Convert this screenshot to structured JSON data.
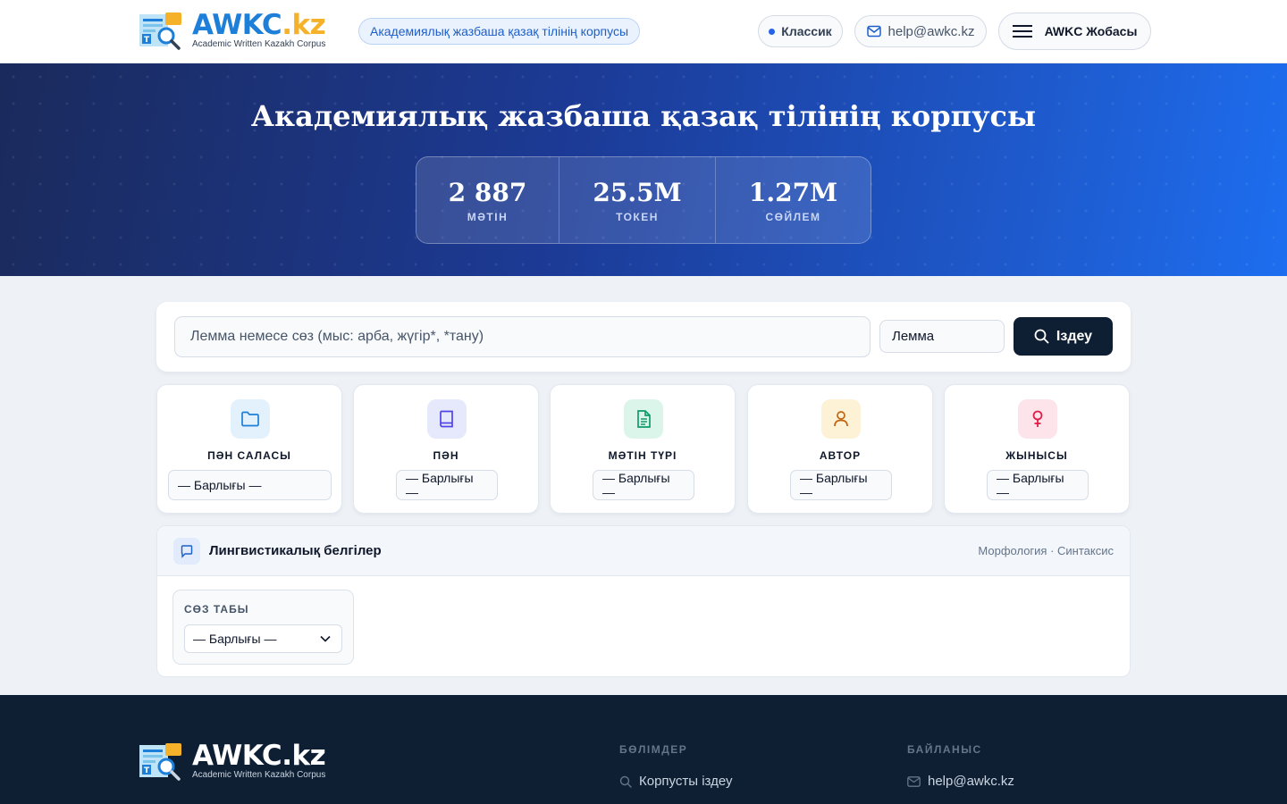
{
  "header": {
    "logo_title": "AWKC",
    "logo_tld": ".kz",
    "logo_sub": "Academic Written Kazakh Corpus",
    "corpus_pill": "Академиялық жазбаша қазақ тілінің корпусы",
    "classic_label": "Классик",
    "email": "help@awkc.kz",
    "project_label": "AWKC Жобасы"
  },
  "hero": {
    "title": "Академиялық жазбаша қазақ тілінің корпусы",
    "stats": [
      {
        "value": "2 887",
        "label": "МӘТІН"
      },
      {
        "value": "25.5M",
        "label": "ТОКЕН"
      },
      {
        "value": "1.27M",
        "label": "СӨЙЛЕМ"
      }
    ]
  },
  "search": {
    "placeholder": "Лемма немесе сөз (мыс: арба, жүгір*, *тану)",
    "mode": "Лемма",
    "button": "Іздеу"
  },
  "filters": [
    {
      "label": "ПӘН САЛАСЫ",
      "value": "— Барлығы —",
      "icon": "folder-icon",
      "icon_color": "#1d7fd8",
      "icon_bg": "#e3f1fc"
    },
    {
      "label": "ПӘН",
      "value": "— Барлығы —",
      "icon": "book-icon",
      "icon_color": "#4f46e5",
      "icon_bg": "#e6e8fb"
    },
    {
      "label": "МӘТІН ТҮРІ",
      "value": "— Барлығы —",
      "icon": "document-icon",
      "icon_color": "#0f9d6a",
      "icon_bg": "#dcf5ea"
    },
    {
      "label": "АВТОР",
      "value": "— Барлығы —",
      "icon": "user-icon",
      "icon_color": "#c2640f",
      "icon_bg": "#fdf1d6"
    },
    {
      "label": "ЖЫНЫСЫ",
      "value": "— Барлығы —",
      "icon": "gender-female-icon",
      "icon_color": "#e11d48",
      "icon_bg": "#fde4ea"
    }
  ],
  "linguistic": {
    "title": "Лингвистикалық белгілер",
    "meta": "Морфология · Синтаксис",
    "pos_label": "СӨЗ ТАБЫ",
    "pos_value": "— Барлығы —"
  },
  "footer": {
    "logo_title": "AWKC",
    "logo_tld": ".kz",
    "logo_sub": "Academic Written Kazakh Corpus",
    "sections_title": "БӨЛІМДЕР",
    "search_link": "Корпусты іздеу",
    "contact_title": "БАЙЛАНЫС",
    "contact_email": "help@awkc.kz"
  }
}
